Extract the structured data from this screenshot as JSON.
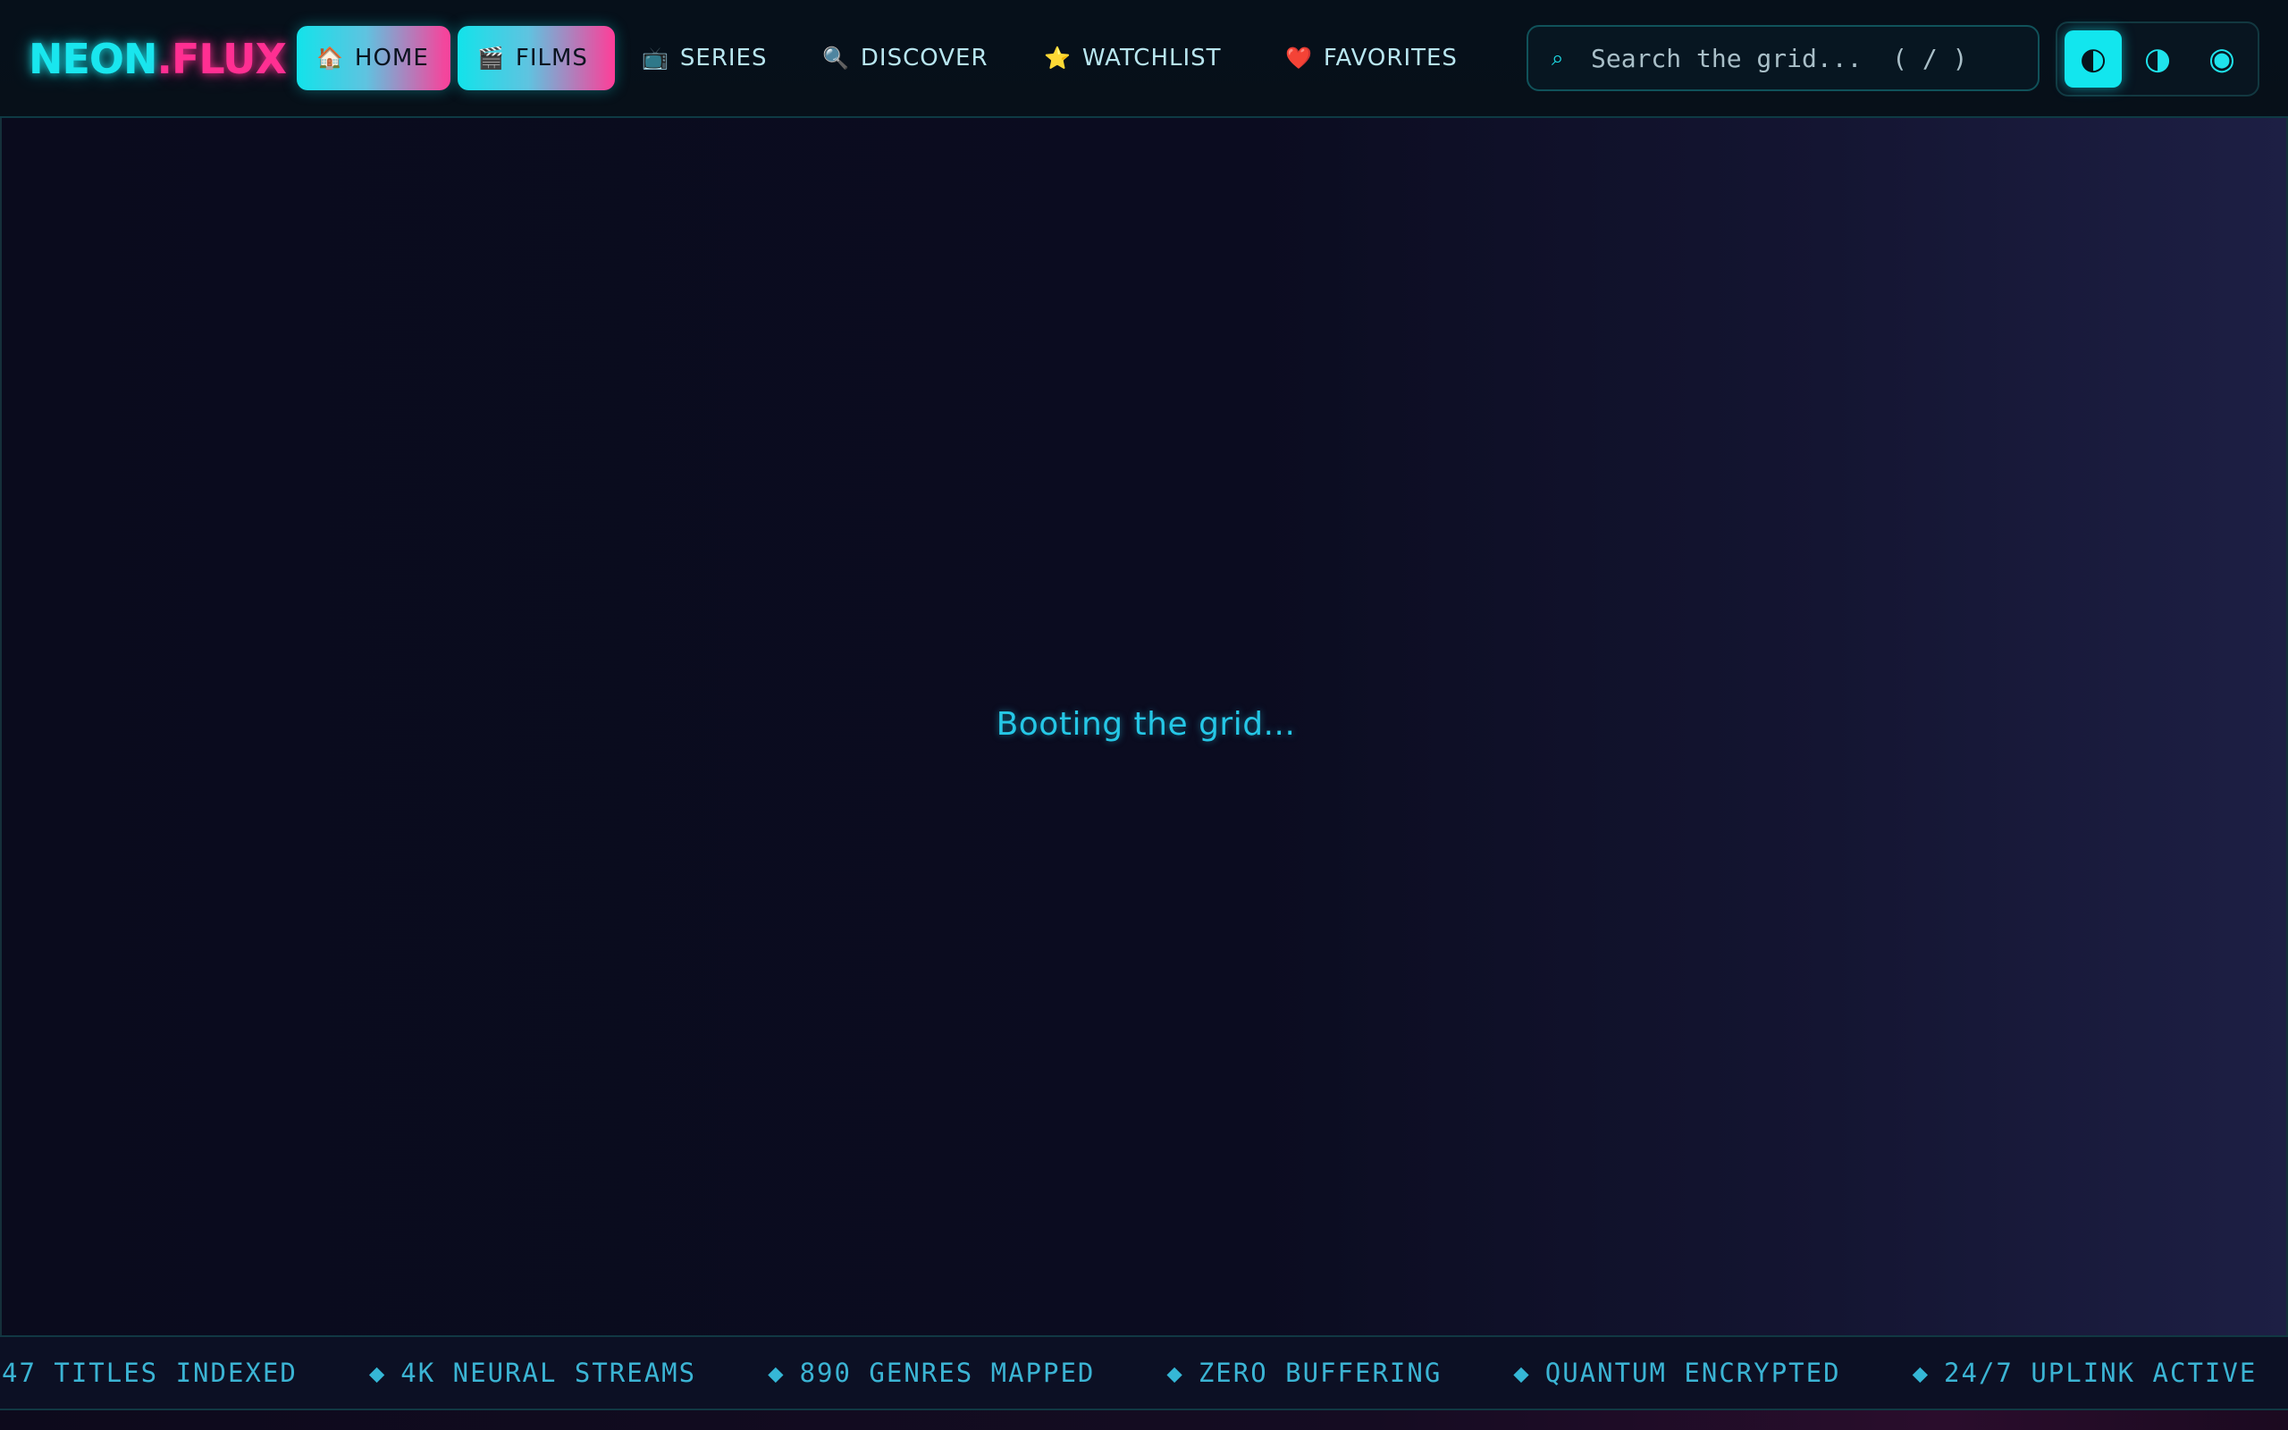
{
  "header": {
    "logo": {
      "part1": "NEON",
      "part2": ".FLUX"
    },
    "nav": [
      {
        "label": "HOME",
        "icon": "🏠",
        "icon_name": "home-icon",
        "active": true
      },
      {
        "label": "FILMS",
        "icon": "🎬",
        "icon_name": "clapper-icon",
        "active": true
      },
      {
        "label": "SERIES",
        "icon": "📺",
        "icon_name": "tv-icon",
        "active": false
      },
      {
        "label": "DISCOVER",
        "icon": "🔍",
        "icon_name": "magnifier-icon",
        "active": false
      },
      {
        "label": "WATCHLIST",
        "icon": "⭐",
        "icon_name": "star-icon",
        "active": false
      },
      {
        "label": "FAVORITES",
        "icon": "❤️",
        "icon_name": "heart-icon",
        "active": false
      }
    ],
    "search": {
      "placeholder": "Search the grid...  ( / )",
      "icon": "⌕",
      "icon_name": "search-icon"
    },
    "modes": [
      {
        "icon": "◐",
        "icon_name": "contrast-dark-icon",
        "active": true
      },
      {
        "icon": "◑",
        "icon_name": "contrast-light-icon",
        "active": false
      },
      {
        "icon": "◉",
        "icon_name": "radio-target-icon",
        "active": false
      }
    ]
  },
  "main": {
    "loading_text": "Booting the grid..."
  },
  "ticker": {
    "items": [
      {
        "text": "47 TITLES INDEXED",
        "diamond": ""
      },
      {
        "text": "4K NEURAL STREAMS",
        "diamond": "◆"
      },
      {
        "text": "890 GENRES MAPPED",
        "diamond": "◆"
      },
      {
        "text": "ZERO BUFFERING",
        "diamond": "◆"
      },
      {
        "text": "QUANTUM ENCRYPTED",
        "diamond": "◆"
      },
      {
        "text": "24/7 UPLINK ACTIVE",
        "diamond": "◆"
      }
    ]
  },
  "colors": {
    "accent_cyan": "#12e3ea",
    "accent_pink": "#ff3d98",
    "background": "#0a0c1c",
    "text_muted": "#b8e6f0"
  }
}
